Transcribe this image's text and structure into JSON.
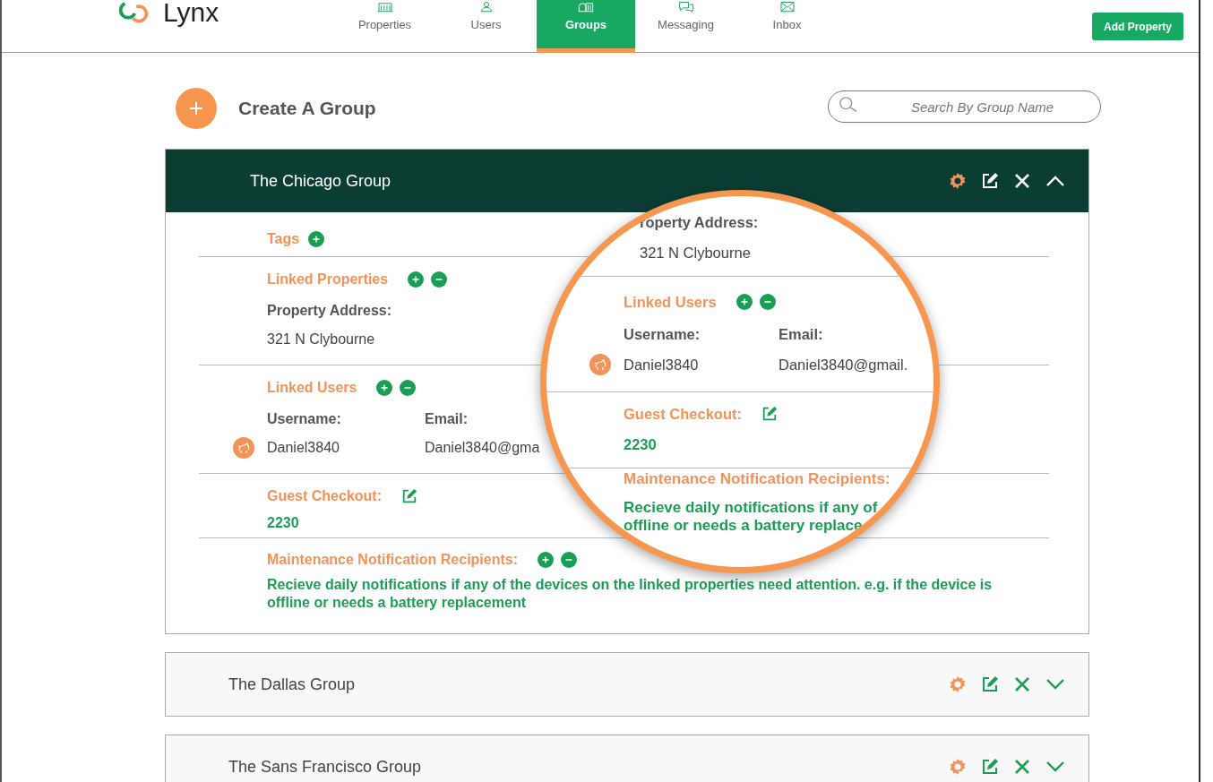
{
  "app": {
    "logo": "Lynx"
  },
  "nav": [
    {
      "label": "Properties",
      "selected": false
    },
    {
      "label": "Users",
      "selected": false
    },
    {
      "label": "Groups",
      "selected": true
    },
    {
      "label": "Messaging",
      "selected": false
    },
    {
      "label": "Inbox",
      "selected": false
    }
  ],
  "add_button": "Add Property",
  "create": {
    "label": "Create A Group"
  },
  "search": {
    "placeholder": "Search By Group Name"
  },
  "groups": [
    {
      "name": "The Chicago Group",
      "expanded": true,
      "sections": [
        {
          "kind": "tags",
          "title": "Tags",
          "can_add": true
        },
        {
          "kind": "list",
          "title": "Linked Properties",
          "can_add": true,
          "can_remove": true,
          "columns": [
            "Property Address:"
          ],
          "rows": [
            {
              "avatar": false,
              "cells": [
                "321 N Clybourne"
              ]
            }
          ]
        },
        {
          "kind": "list",
          "title": "Linked Users",
          "can_add": true,
          "can_remove": true,
          "columns": [
            "Username:",
            "Email:"
          ],
          "rows": [
            {
              "avatar": true,
              "cells": [
                "Daniel3840",
                "Daniel3840@gma"
              ]
            }
          ]
        },
        {
          "kind": "value",
          "title": "Guest Checkout:",
          "editable": true,
          "value": "2230"
        },
        {
          "kind": "note",
          "title": "Maintenance Notification Recipients:",
          "can_add": true,
          "can_remove": true,
          "lines": [
            "Recieve daily notifications if any of the devices on the linked properties need attention. e.g. if the device is",
            "offline or needs a battery replacement"
          ]
        }
      ]
    },
    {
      "name": "The Dallas Group",
      "expanded": false
    },
    {
      "name": "The Sans Francisco Group",
      "expanded": false
    }
  ],
  "magnifier": {
    "sections": [
      {
        "kind": "list",
        "columns": [
          "roperty Address:"
        ],
        "rows": [
          {
            "avatar": false,
            "cells": [
              "321 N Clybourne"
            ]
          }
        ]
      },
      {
        "kind": "list",
        "title": "Linked Users",
        "can_add": true,
        "can_remove": true,
        "columns": [
          "Username:",
          "Email:"
        ],
        "rows": [
          {
            "avatar": true,
            "cells": [
              "Daniel3840",
              "Daniel3840@gmail."
            ]
          }
        ]
      },
      {
        "kind": "value",
        "title": "Guest Checkout:",
        "editable": true,
        "value": "2230"
      },
      {
        "kind": "note",
        "title": "Maintenance Notification Recipients:",
        "lines": [
          "Recieve daily notifications if any of",
          "offline or needs a battery replace"
        ]
      }
    ]
  }
}
